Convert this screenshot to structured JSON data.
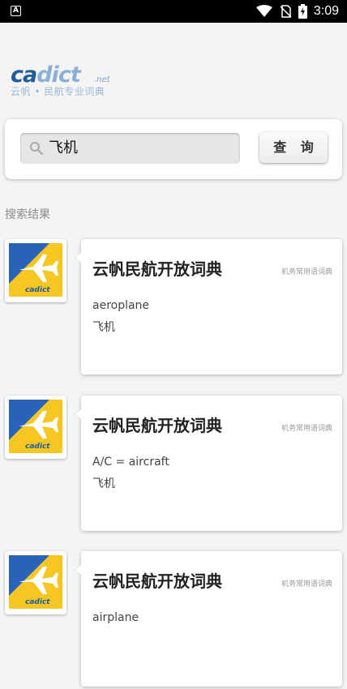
{
  "status_bar": {
    "time": "3:09",
    "left_icon_letter": "A"
  },
  "logo": {
    "word_ca": "ca",
    "word_dict": "dict",
    "domain": ".net",
    "tagline": "云帆 • 民航专业词典"
  },
  "search": {
    "query": "飞机",
    "placeholder": "",
    "button_label": "查 询"
  },
  "results_label": "搜索结果",
  "results": [
    {
      "title": "云帆民航开放词典",
      "tag": "机务常用语词典",
      "term": "aeroplane",
      "meaning": "飞机"
    },
    {
      "title": "云帆民航开放词典",
      "tag": "机务常用语词典",
      "term": "A/C = aircraft",
      "meaning": "飞机"
    },
    {
      "title": "云帆民航开放词典",
      "tag": "机务常用语词典",
      "term": "airplane",
      "meaning": ""
    }
  ],
  "colors": {
    "brand_blue": "#1f5c9e",
    "thumb_yellow": "#f6c623",
    "thumb_blue": "#2a62b8"
  }
}
